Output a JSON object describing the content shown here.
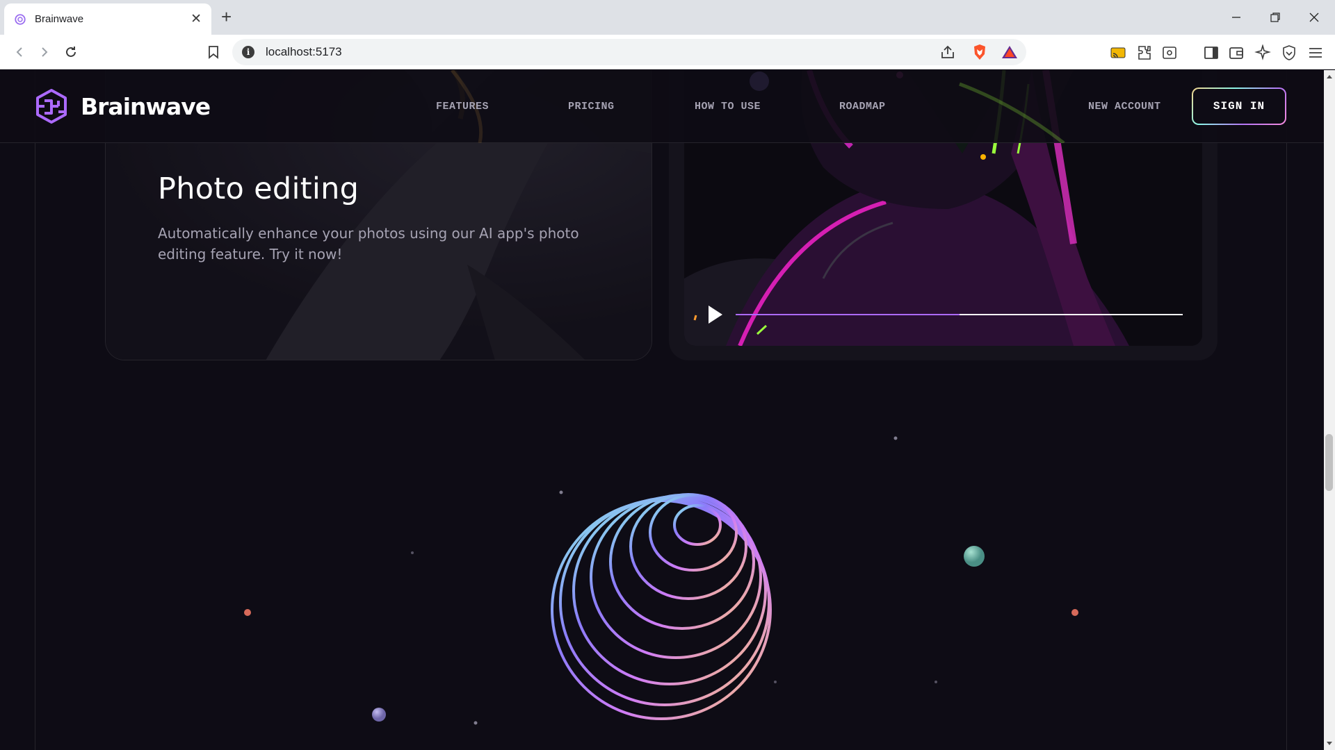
{
  "browser": {
    "tab_title": "Brainwave",
    "url": "localhost:5173"
  },
  "header": {
    "brand": "Brainwave",
    "nav": [
      "FEATURES",
      "PRICING",
      "HOW TO USE",
      "ROADMAP"
    ],
    "new_account": "NEW ACCOUNT",
    "sign_in": "SIGN IN"
  },
  "feature": {
    "title": "Photo editing",
    "description": "Automatically enhance your photos using our AI app's photo editing feature. Try it now!"
  },
  "video": {
    "progress": 0.5
  },
  "colors": {
    "background": "#0e0c15",
    "accent": "#ac6aff",
    "text_muted": "#a6a3b3"
  }
}
